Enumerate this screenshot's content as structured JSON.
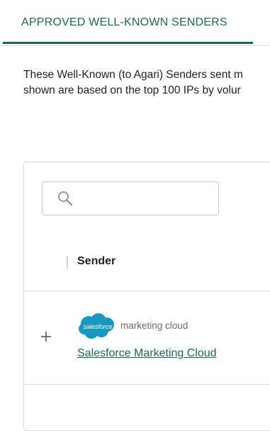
{
  "tab": {
    "label": "APPROVED WELL-KNOWN SENDERS"
  },
  "description": {
    "line1": "These Well-Known (to Agari) Senders sent m",
    "line2": "shown are based on the top 100 IPs by volur"
  },
  "search": {
    "placeholder": "",
    "value": ""
  },
  "table": {
    "columns": [
      "Sender"
    ],
    "rows": [
      {
        "expand_symbol": "+",
        "logo": {
          "icon": "salesforce-cloud-logo",
          "cloud_text": "salesforce",
          "text": "marketing cloud"
        },
        "sender_name": "Salesforce Marketing Cloud"
      }
    ]
  },
  "colors": {
    "accent": "#1a6b52",
    "salesforce_blue": "#1798c1",
    "border": "#dadada"
  }
}
